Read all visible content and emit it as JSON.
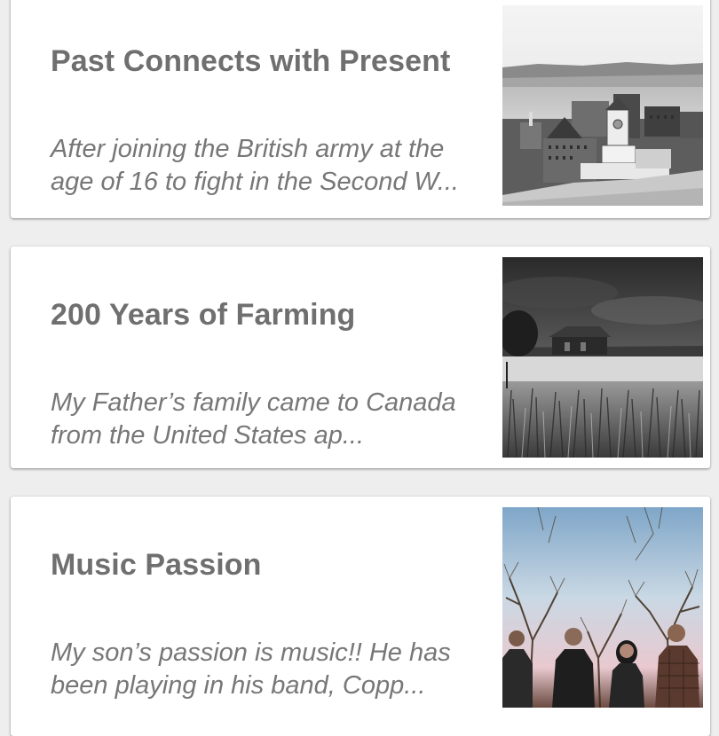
{
  "stories": [
    {
      "title": "Past Connects with Present",
      "excerpt": "After joining the British army at the age of 16 to fight in the Second W...",
      "thumbnail": "old-city-harbour-photo"
    },
    {
      "title": "200 Years of Farming",
      "excerpt": "My Father’s family came to Canada from the United States ap...",
      "thumbnail": "farm-barn-field-photo"
    },
    {
      "title": "Music Passion",
      "excerpt": "My son’s passion is music!! He has been playing in his band, Copp...",
      "thumbnail": "band-in-trees-photo"
    }
  ],
  "colors": {
    "background": "#eeeeee",
    "card": "#ffffff",
    "title_text": "#6f6f6f",
    "excerpt_text": "#777777"
  }
}
